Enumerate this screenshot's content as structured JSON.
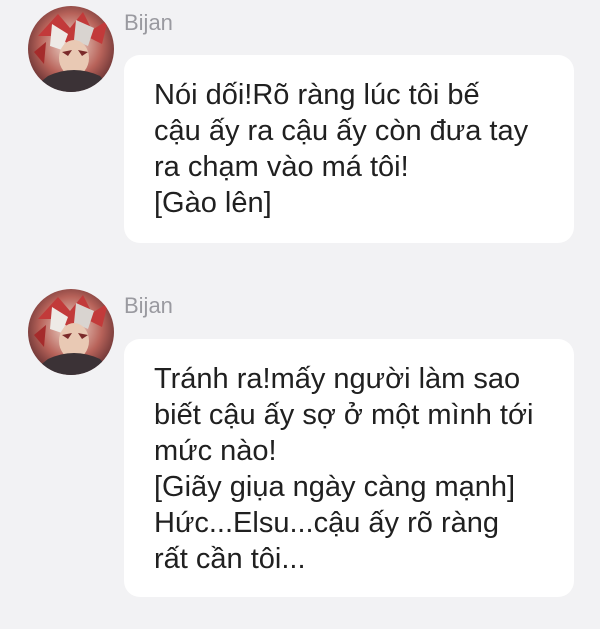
{
  "messages": [
    {
      "sender": "Bijan",
      "avatar_icon": "character-avatar-icon",
      "lines": [
        "Nói dối!Rõ ràng lúc tôi bế",
        "cậu ấy ra cậu ấy còn đưa tay",
        "ra chạm vào má tôi!",
        "[Gào lên]"
      ]
    },
    {
      "sender": "Bijan",
      "avatar_icon": "character-avatar-icon",
      "lines": [
        "Tránh ra!mấy người làm sao",
        "biết cậu ấy sợ ở một mình tới",
        "mức nào!",
        "[Giãy giụa ngày càng mạnh]",
        "Hức...Elsu...cậu ấy rõ ràng",
        "rất cần tôi..."
      ]
    }
  ],
  "colors": {
    "background": "#f2f2f4",
    "bubble": "#ffffff",
    "sender_name": "#9a9aa0",
    "message_text": "#202020",
    "avatar_hair": "#c23a3a",
    "avatar_skin": "#e9c9b4"
  }
}
